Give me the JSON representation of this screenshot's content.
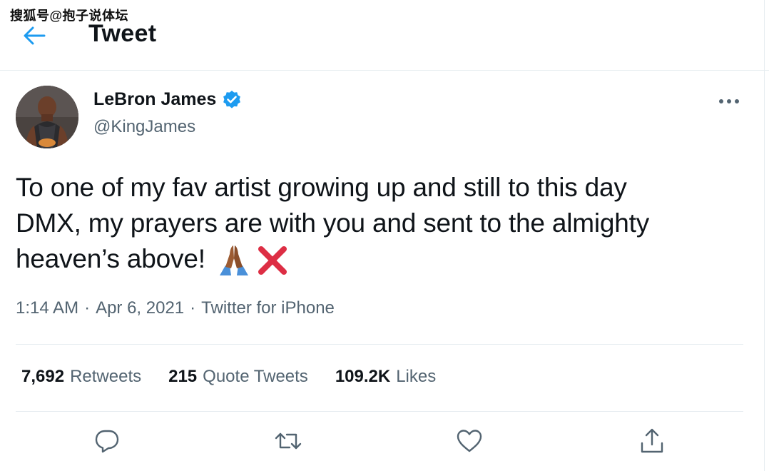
{
  "watermark": "搜狐号@抱子说体坛",
  "header": {
    "title": "Tweet",
    "back_icon": "arrow-left-icon"
  },
  "tweet": {
    "author": {
      "display_name": "LeBron James",
      "handle": "@KingJames",
      "verified_icon": "verified-badge-icon"
    },
    "text_lines": [
      "To one of my fav artist growing up and still to this day",
      "DMX, my prayers are with you and sent to the almighty",
      "heaven’s above!"
    ],
    "emojis": [
      "folded-hands-emoji",
      "cross-mark-emoji"
    ],
    "time": "1:14 AM",
    "sep": "·",
    "date": "Apr 6, 2021",
    "source": "Twitter for iPhone"
  },
  "stats": [
    {
      "count": "7,692",
      "label": "Retweets"
    },
    {
      "count": "215",
      "label": "Quote Tweets"
    },
    {
      "count": "109.2K",
      "label": "Likes"
    }
  ],
  "actions": [
    "reply-icon",
    "retweet-icon",
    "like-icon",
    "share-icon"
  ],
  "colors": {
    "accent": "#1d9bf0",
    "secondary_text": "#536471",
    "divider": "#e6ecf0"
  }
}
